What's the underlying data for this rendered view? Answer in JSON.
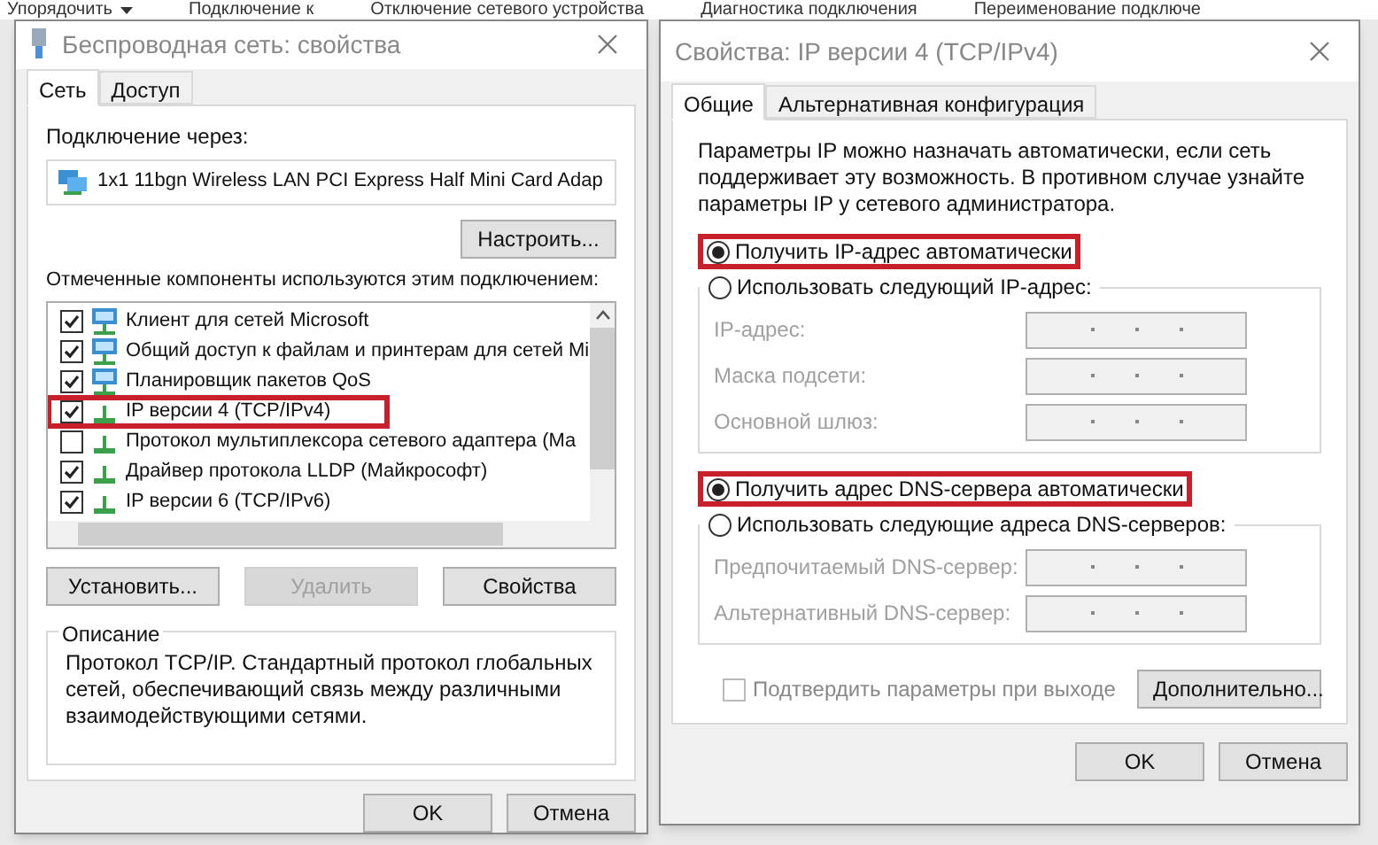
{
  "background_toolbar": {
    "items": [
      {
        "label": "Упорядочить",
        "dropdown": true
      },
      {
        "label": "Подключение к",
        "dropdown": false
      },
      {
        "label": "Отключение сетевого устройства",
        "dropdown": false
      },
      {
        "label": "Диагностика подключения",
        "dropdown": false
      },
      {
        "label": "Переименование подключе",
        "dropdown": false
      }
    ]
  },
  "properties_dialog": {
    "title": "Беспроводная сеть: свойства",
    "tabs": [
      {
        "label": "Сеть",
        "selected": true
      },
      {
        "label": "Доступ",
        "selected": false
      }
    ],
    "connect_via_label": "Подключение через:",
    "adapter": "1x1 11bgn Wireless LAN PCI Express Half Mini Card Adap",
    "configure_button": "Настроить...",
    "components_label": "Отмеченные компоненты используются этим подключением:",
    "components": [
      {
        "label": "Клиент для сетей Microsoft",
        "checked": true,
        "highlighted": false,
        "kind": "service"
      },
      {
        "label": "Общий доступ к файлам и принтерам для сетей Mi",
        "checked": true,
        "highlighted": false,
        "kind": "service"
      },
      {
        "label": "Планировщик пакетов QoS",
        "checked": true,
        "highlighted": false,
        "kind": "service"
      },
      {
        "label": "IP версии 4 (TCP/IPv4)",
        "checked": true,
        "highlighted": true,
        "kind": "protocol"
      },
      {
        "label": "Протокол мультиплексора сетевого адаптера (Ма",
        "checked": false,
        "highlighted": false,
        "kind": "protocol"
      },
      {
        "label": "Драйвер протокола LLDP (Майкрософт)",
        "checked": true,
        "highlighted": false,
        "kind": "protocol"
      },
      {
        "label": "IP версии 6 (TCP/IPv6)",
        "checked": true,
        "highlighted": false,
        "kind": "protocol"
      }
    ],
    "buttons": [
      {
        "label": "Установить...",
        "disabled": false
      },
      {
        "label": "Удалить",
        "disabled": true
      },
      {
        "label": "Свойства",
        "disabled": false
      }
    ],
    "description": {
      "title": "Описание",
      "text": "Протокол TCP/IP. Стандартный протокол глобальных сетей, обеспечивающий связь между различными взаимодействующими сетями."
    },
    "footer_buttons": [
      "OK",
      "Отмена"
    ]
  },
  "ipv4_dialog": {
    "title": "Свойства: IP версии 4 (TCP/IPv4)",
    "tabs": [
      {
        "label": "Общие",
        "selected": true
      },
      {
        "label": "Альтернативная конфигурация",
        "selected": false
      }
    ],
    "intro": "Параметры IP можно назначать автоматически, если сеть поддерживает эту возможность. В противном случае узнайте параметры IP у сетевого администратора.",
    "ip_auto": {
      "label": "Получить IP-адрес автоматически",
      "selected": true,
      "highlighted": true
    },
    "ip_manual": {
      "label": "Использовать следующий IP-адрес:",
      "selected": false,
      "highlighted": false,
      "fields": [
        {
          "label": "IP-адрес:",
          "disabled": true
        },
        {
          "label": "Маска подсети:",
          "disabled": true
        },
        {
          "label": "Основной шлюз:",
          "disabled": true
        }
      ]
    },
    "dns_auto": {
      "label": "Получить адрес DNS-сервера автоматически",
      "selected": true,
      "highlighted": true
    },
    "dns_manual": {
      "label": "Использовать следующие адреса DNS-серверов:",
      "selected": false,
      "highlighted": false,
      "fields": [
        {
          "label": "Предпочитаемый DNS-сервер:",
          "disabled": true
        },
        {
          "label": "Альтернативный DNS-сервер:",
          "disabled": true
        }
      ]
    },
    "validate": {
      "label": "Подтвердить параметры при выходе",
      "checked": false,
      "disabled": true
    },
    "advanced_button": "Дополнительно...",
    "footer_buttons": [
      "OK",
      "Отмена"
    ]
  }
}
